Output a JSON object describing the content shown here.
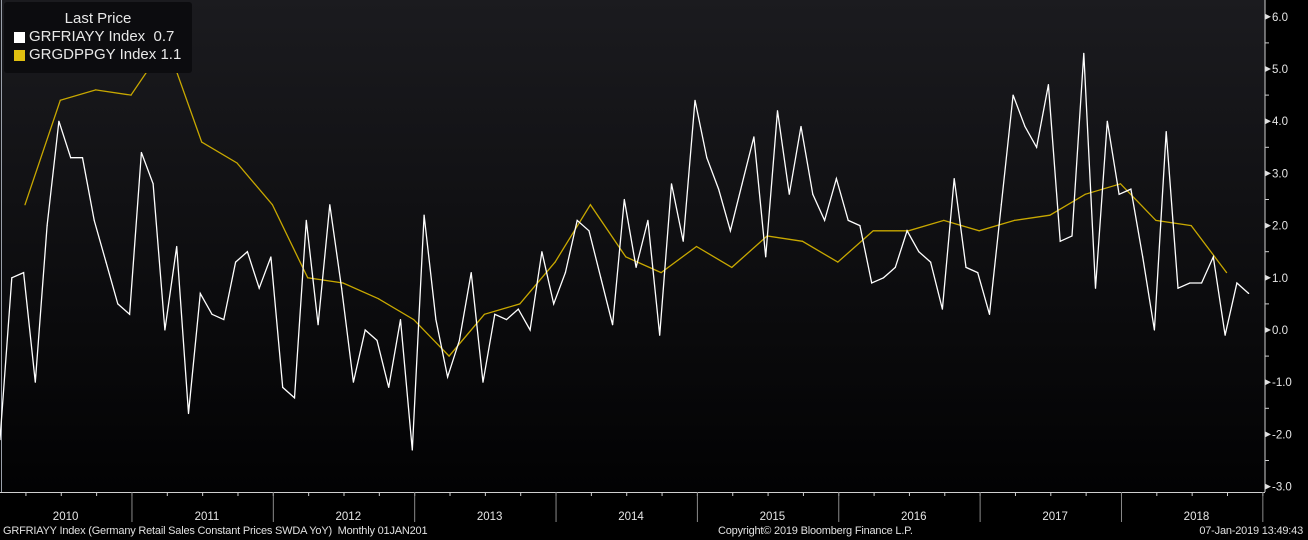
{
  "legend": {
    "title": "Last Price",
    "items": [
      {
        "name": "GRFRIAYY Index",
        "last": "0.7",
        "color": "#ffffff"
      },
      {
        "name": "GRGDPPGY Index",
        "last": "1.1",
        "color": "#d4b000"
      }
    ]
  },
  "footer": {
    "description": "GRFRIAYY Index (Germany Retail Sales Constant Prices SWDA YoY)  Monthly 01JAN201",
    "copyright": "Copyright© 2019 Bloomberg Finance L.P.",
    "timestamp": "07-Jan-2019 13:49:43"
  },
  "chart_data": {
    "type": "line",
    "title": "",
    "xlabel": "",
    "ylabel": "",
    "ylim": [
      -3.0,
      6.0
    ],
    "y_ticks": [
      "6.0",
      "5.0",
      "4.0",
      "3.0",
      "2.0",
      "1.0",
      "0.0",
      "-1.0",
      "-2.0",
      "-3.0"
    ],
    "x_ticks": [
      "2010",
      "2011",
      "2012",
      "2013",
      "2014",
      "2015",
      "2016",
      "2017",
      "2018"
    ],
    "grid": false,
    "legend_position": "top-left",
    "series": [
      {
        "name": "GRFRIAYY Index",
        "frequency": "monthly",
        "start": "2010-01",
        "color": "#ffffff",
        "values": [
          -2.1,
          1.0,
          1.1,
          -1.0,
          2.0,
          4.0,
          3.3,
          3.3,
          2.1,
          1.3,
          0.5,
          0.3,
          3.4,
          2.8,
          0.0,
          1.6,
          -1.6,
          0.7,
          0.3,
          0.2,
          1.3,
          1.5,
          0.8,
          1.4,
          -1.1,
          -1.3,
          2.1,
          0.1,
          2.4,
          0.8,
          -1.0,
          0.0,
          -0.2,
          -1.1,
          0.2,
          -2.3,
          2.2,
          0.2,
          -0.9,
          -0.2,
          1.1,
          -1.0,
          0.3,
          0.2,
          0.4,
          0.0,
          1.5,
          0.5,
          1.1,
          2.1,
          1.9,
          1.0,
          0.1,
          2.5,
          1.2,
          2.1,
          -0.1,
          2.8,
          1.7,
          4.4,
          3.3,
          2.7,
          1.9,
          2.8,
          3.7,
          1.4,
          4.2,
          2.6,
          3.9,
          2.6,
          2.1,
          2.9,
          2.1,
          2.0,
          0.9,
          1.0,
          1.2,
          1.9,
          1.5,
          1.3,
          0.4,
          2.9,
          1.2,
          1.1,
          0.3,
          2.4,
          4.5,
          3.9,
          3.5,
          4.7,
          1.7,
          1.8,
          5.3,
          0.8,
          4.0,
          2.6,
          2.7,
          1.4,
          0.0,
          3.8,
          0.8,
          0.9,
          0.9,
          1.4,
          -0.1,
          0.9,
          0.7
        ]
      },
      {
        "name": "GRGDPPGY Index",
        "frequency": "quarterly",
        "start": "2010-Q1",
        "color": "#c8a800",
        "values": [
          2.4,
          4.4,
          4.6,
          4.5,
          5.5,
          3.6,
          3.2,
          2.4,
          1.0,
          0.9,
          0.6,
          0.2,
          -0.5,
          0.3,
          0.5,
          1.3,
          2.4,
          1.4,
          1.1,
          1.6,
          1.2,
          1.8,
          1.7,
          1.3,
          1.9,
          1.9,
          2.1,
          1.9,
          2.1,
          2.2,
          2.6,
          2.8,
          2.1,
          2.0,
          1.1
        ]
      }
    ]
  }
}
